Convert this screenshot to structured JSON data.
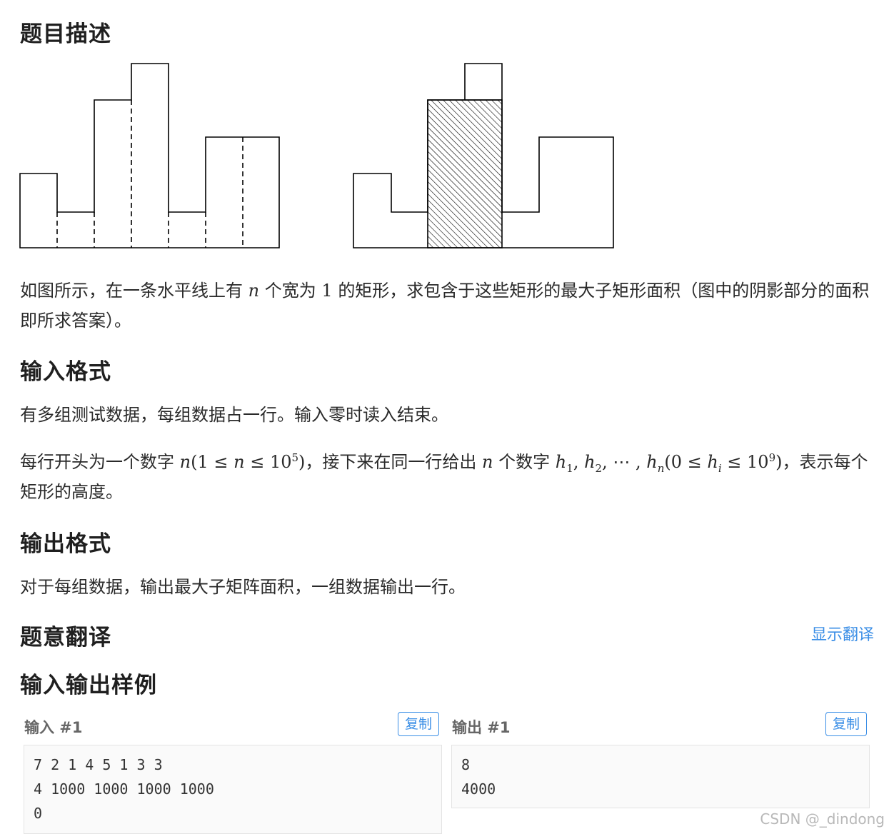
{
  "sections": {
    "desc_title": "题目描述",
    "input_title": "输入格式",
    "output_title": "输出格式",
    "translate_title": "题意翻译",
    "samples_title": "输入输出样例"
  },
  "desc": {
    "p1a": "如图所示，在一条水平线上有",
    "p1n": "n",
    "p1b": "个宽为",
    "p1one": "1",
    "p1c": "的矩形，求包含于这些矩形的最大子矩形面积（图中的阴影部分的面积即所求答案）。"
  },
  "input": {
    "p1": "有多组测试数据，每组数据占一行。输入零时读入结束。",
    "p2a": "每行开头为一个数字",
    "p2b": "，接下来在同一行给出",
    "p2c": "个数字",
    "p2d": "，表示每个矩形的高度。"
  },
  "output": {
    "p1": "对于每组数据，输出最大子矩阵面积，一组数据输出一行。"
  },
  "translate": {
    "toggle": "显示翻译"
  },
  "samples": {
    "input_label": "输入 #1",
    "output_label": "输出 #1",
    "copy": "复制",
    "input_text": "7 2 1 4 5 1 3 3\n4 1000 1000 1000 1000\n0",
    "output_text": "8\n4000"
  },
  "watermark": "CSDN @_dindong"
}
